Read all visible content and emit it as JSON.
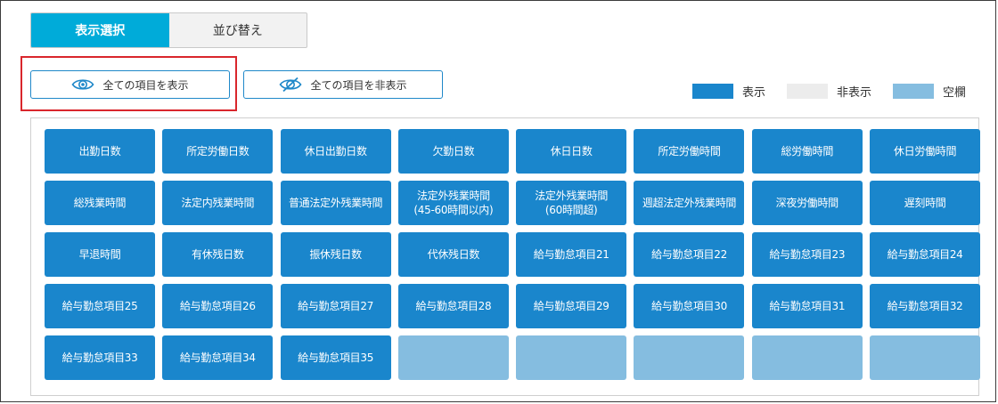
{
  "tabs": [
    {
      "label": "表示選択",
      "active": true
    },
    {
      "label": "並び替え",
      "active": false
    }
  ],
  "actions": {
    "show_all_label": "全ての項目を表示",
    "hide_all_label": "全ての項目を非表示"
  },
  "legend": [
    {
      "label": "表示",
      "color": "#1a86cc"
    },
    {
      "label": "非表示",
      "color": "#ececec"
    },
    {
      "label": "空欄",
      "color": "#85bde0"
    }
  ],
  "colors": {
    "accent": "#00abd9",
    "item_shown": "#1a86cc",
    "item_hidden": "#ececec",
    "item_empty": "#85bde0",
    "highlight": "#d9262c"
  },
  "items": [
    {
      "label": "出勤日数",
      "state": "shown"
    },
    {
      "label": "所定労働日数",
      "state": "shown"
    },
    {
      "label": "休日出勤日数",
      "state": "shown"
    },
    {
      "label": "欠勤日数",
      "state": "shown"
    },
    {
      "label": "休日日数",
      "state": "shown"
    },
    {
      "label": "所定労働時間",
      "state": "shown"
    },
    {
      "label": "総労働時間",
      "state": "shown"
    },
    {
      "label": "休日労働時間",
      "state": "shown"
    },
    {
      "label": "総残業時間",
      "state": "shown"
    },
    {
      "label": "法定内残業時間",
      "state": "shown"
    },
    {
      "label": "普通法定外残業時間",
      "state": "shown"
    },
    {
      "label": "法定外残業時間\n(45-60時間以内)",
      "state": "shown"
    },
    {
      "label": "法定外残業時間\n(60時間超)",
      "state": "shown"
    },
    {
      "label": "週超法定外残業時間",
      "state": "shown"
    },
    {
      "label": "深夜労働時間",
      "state": "shown"
    },
    {
      "label": "遅刻時間",
      "state": "shown"
    },
    {
      "label": "早退時間",
      "state": "shown"
    },
    {
      "label": "有休残日数",
      "state": "shown"
    },
    {
      "label": "振休残日数",
      "state": "shown"
    },
    {
      "label": "代休残日数",
      "state": "shown"
    },
    {
      "label": "給与勤怠項目21",
      "state": "shown"
    },
    {
      "label": "給与勤怠項目22",
      "state": "shown"
    },
    {
      "label": "給与勤怠項目23",
      "state": "shown"
    },
    {
      "label": "給与勤怠項目24",
      "state": "shown"
    },
    {
      "label": "給与勤怠項目25",
      "state": "shown"
    },
    {
      "label": "給与勤怠項目26",
      "state": "shown"
    },
    {
      "label": "給与勤怠項目27",
      "state": "shown"
    },
    {
      "label": "給与勤怠項目28",
      "state": "shown"
    },
    {
      "label": "給与勤怠項目29",
      "state": "shown"
    },
    {
      "label": "給与勤怠項目30",
      "state": "shown"
    },
    {
      "label": "給与勤怠項目31",
      "state": "shown"
    },
    {
      "label": "給与勤怠項目32",
      "state": "shown"
    },
    {
      "label": "給与勤怠項目33",
      "state": "shown"
    },
    {
      "label": "給与勤怠項目34",
      "state": "shown"
    },
    {
      "label": "給与勤怠項目35",
      "state": "shown"
    },
    {
      "label": "",
      "state": "empty"
    },
    {
      "label": "",
      "state": "empty"
    },
    {
      "label": "",
      "state": "empty"
    },
    {
      "label": "",
      "state": "empty"
    },
    {
      "label": "",
      "state": "empty"
    }
  ]
}
